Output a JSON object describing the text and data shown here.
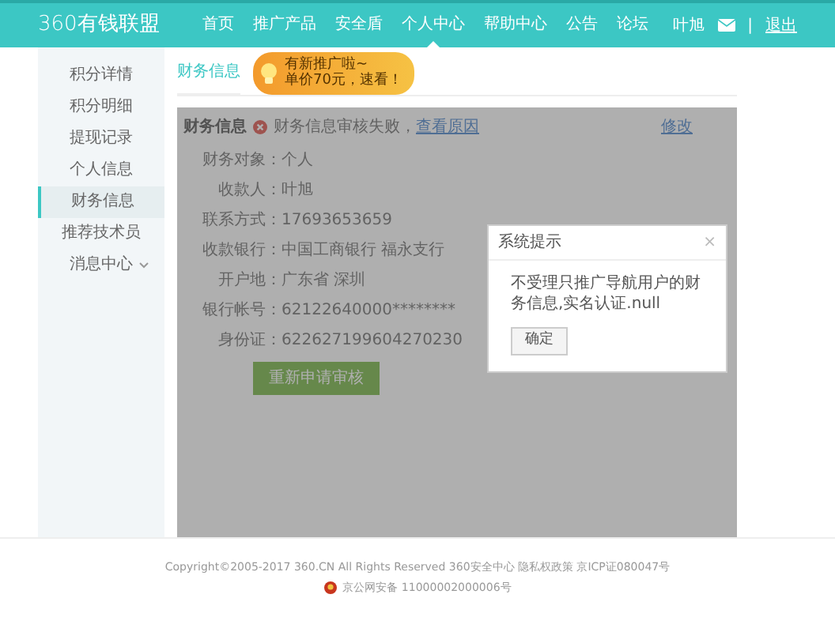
{
  "header": {
    "logo": "360有钱联盟",
    "nav": [
      {
        "label": "首页",
        "selected": false
      },
      {
        "label": "推广产品",
        "selected": false
      },
      {
        "label": "安全盾",
        "selected": false
      },
      {
        "label": "个人中心",
        "selected": true
      },
      {
        "label": "帮助中心",
        "selected": false
      },
      {
        "label": "公告",
        "selected": false
      },
      {
        "label": "论坛",
        "selected": false
      }
    ],
    "user": "叶旭",
    "separator": "|",
    "logout": "退出"
  },
  "promo_tooltip": {
    "lines": [
      "有新推广啦~",
      "单价70元，速看！"
    ]
  },
  "sidebar": {
    "items": [
      {
        "label": "积分详情",
        "selected": false,
        "expandable": false
      },
      {
        "label": "积分明细",
        "selected": false,
        "expandable": false
      },
      {
        "label": "提现记录",
        "selected": false,
        "expandable": false
      },
      {
        "label": "个人信息",
        "selected": false,
        "expandable": false
      },
      {
        "label": "财务信息",
        "selected": true,
        "expandable": false
      },
      {
        "label": "推荐技术员",
        "selected": false,
        "expandable": false
      },
      {
        "label": "消息中心",
        "selected": false,
        "expandable": true
      }
    ]
  },
  "breadcrumb": "财务信息",
  "panel": {
    "title": "财务信息",
    "status": "财务信息审核失败，",
    "status_link": "查看原因",
    "edit_link": "修改",
    "fields": [
      {
        "label": "财务对象：",
        "value": "个人"
      },
      {
        "label": "收款人：",
        "value": "叶旭"
      },
      {
        "label": "联系方式：",
        "value": "17693653659"
      },
      {
        "label": "收款银行：",
        "value": "中国工商银行 福永支行"
      },
      {
        "label": "开户地：",
        "value": "广东省 深圳"
      },
      {
        "label": "银行帐号：",
        "value": "62122640000********"
      },
      {
        "label": "身份证：",
        "value": "622627199604270230"
      }
    ],
    "button": "重新申请审核"
  },
  "dialog": {
    "title": "系统提示",
    "close": "×",
    "message": "不受理只推广导航用户的财务信息,实名认证.null",
    "button": "确定"
  },
  "footer": {
    "copyright": "Copyright©2005-2017 360.CN All Rights Reserved 360安全中心 隐私权政策 京ICP证080047号",
    "police": "京公网安备 11000002000006号"
  }
}
